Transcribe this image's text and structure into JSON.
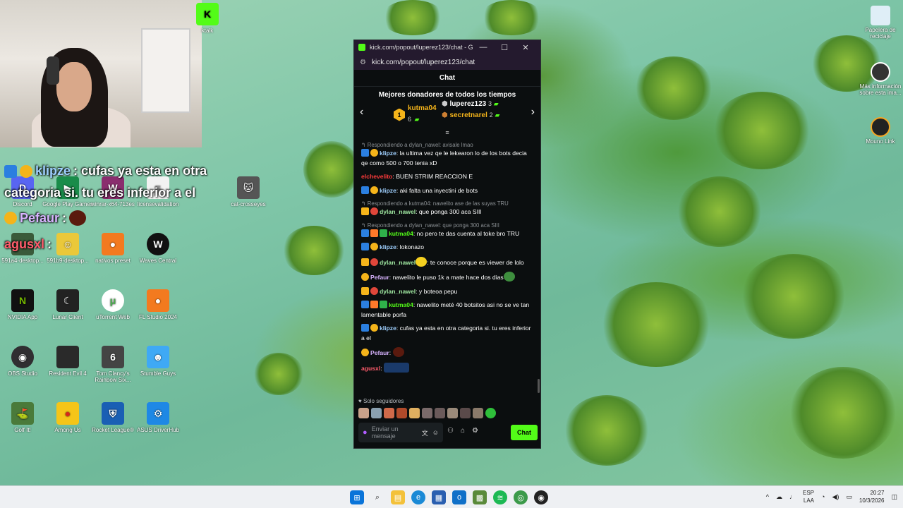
{
  "overlay": {
    "line1_user": "klipze",
    "line1_text": ": cufas ya esta en otra",
    "line2_text": "categoria si. tu eres inferior a el",
    "line3_user": "Pefaur",
    "line3_text": ":",
    "line4_user": "agusxl",
    "line4_text": ":"
  },
  "desktop_icons": [
    {
      "label": "Discord",
      "icon": "discord-icon"
    },
    {
      "label": "Google Play Games",
      "icon": "google-play-games-icon"
    },
    {
      "label": "winrar-x64-713es",
      "icon": "winrar-icon"
    },
    {
      "label": "licensevalidation",
      "icon": "file-icon"
    },
    {
      "label": "cat-crosseyes",
      "icon": "image-icon"
    },
    {
      "label": "591a4-desktop...",
      "icon": "image-icon"
    },
    {
      "label": "591b9-desktop...",
      "icon": "image-icon"
    },
    {
      "label": "nativos preset",
      "icon": "fl-studio-icon"
    },
    {
      "label": "Waves Central",
      "icon": "waves-icon"
    },
    {
      "label": "NVIDIA App",
      "icon": "nvidia-icon"
    },
    {
      "label": "Lunar Client",
      "icon": "lunar-client-icon"
    },
    {
      "label": "uTorrent Web",
      "icon": "utorrent-icon"
    },
    {
      "label": "FL Studio 2024",
      "icon": "fl-studio-icon"
    },
    {
      "label": "OBS Studio",
      "icon": "obs-icon"
    },
    {
      "label": "Resident Evil 4",
      "icon": "game-icon"
    },
    {
      "label": "Tom Clancy's Rainbow Six...",
      "icon": "rainbow-six-icon"
    },
    {
      "label": "Stumble Guys",
      "icon": "stumble-guys-icon"
    },
    {
      "label": "Golf It!",
      "icon": "golf-it-icon"
    },
    {
      "label": "Among Us",
      "icon": "among-us-icon"
    },
    {
      "label": "Rocket League®",
      "icon": "rocket-league-icon"
    },
    {
      "label": "ASUS DriverHub",
      "icon": "asus-icon"
    },
    {
      "label": "Papelera de reciclaje",
      "icon": "recycle-bin-icon"
    },
    {
      "label": "Más información sobre esta ima...",
      "icon": "info-icon"
    },
    {
      "label": "Mouno Link",
      "icon": "mouno-link-icon"
    },
    {
      "label": "ktalk",
      "icon": "kick-icon"
    }
  ],
  "window": {
    "title": "kick.com/popout/luperez123/chat - Googl...",
    "url": "kick.com/popout/luperez123/chat",
    "chat_header": "Chat",
    "donors_title": "Mejores donadores de todos los tiempos",
    "donor1": {
      "name": "kutma04",
      "count": "6",
      "rank": "1"
    },
    "donor2": {
      "name": "luperez123",
      "count": "3"
    },
    "donor3": {
      "name": "secretnarel",
      "count": "2"
    }
  },
  "messages": [
    {
      "reply": "Respondiendo a dylan_nawel: avisale lmao",
      "user": "klipze",
      "text": ": la ultima vez qe le lekearon lo de los bots decia qe como 500 o 700 tenia xD"
    },
    {
      "reply": "",
      "user": "elchevelito",
      "text": ": BUEN STRIM REACCION E"
    },
    {
      "reply": "",
      "user": "klipze",
      "text": ": aki falta una inyectini de bots"
    },
    {
      "reply": "Respondiendo a kutma04: nawelito ase de las suyas TRU",
      "user": "dylan_nawel",
      "text": ": que ponga 300 aca SIII"
    },
    {
      "reply": "Respondiendo a dylan_nawel: que ponga 300 aca SIII",
      "user": "kutma04",
      "text": ": no pero te das cuenta al toke bro TRU"
    },
    {
      "reply": "",
      "user": "klipze",
      "text": ": lokonazo"
    },
    {
      "reply": "",
      "user": "dylan_nawel",
      "text": ": te conoce porque es viewer de lolo"
    },
    {
      "reply": "",
      "user": "Pefaur",
      "text": ": nawelito le puso 1k a mate hace dos dias"
    },
    {
      "reply": "",
      "user": "dylan_nawel",
      "text": ": y boteoa pepu"
    },
    {
      "reply": "",
      "user": "kutma04",
      "text": ": nawelito meté 40 botsitos asi no se ve tan lamentable porfa"
    },
    {
      "reply": "",
      "user": "klipze",
      "text": ": cufas ya esta en otra categoria si. tu eres inferior a el"
    },
    {
      "reply": "",
      "user": "Pefaur",
      "text": ":"
    },
    {
      "reply": "",
      "user": "agusxl",
      "text": ":"
    }
  ],
  "footer": {
    "followers_only": "Solo seguidores",
    "input_placeholder": "Enviar un mensaje",
    "chat_button": "Chat"
  },
  "taskbar": {
    "lang1": "ESP",
    "lang2": "LAA",
    "time": "20:27",
    "date": "10/3/2026"
  },
  "colors": {
    "kick_green": "#53fc18",
    "chat_bg": "#0b0e0f",
    "titlebar_bg": "#241a2e"
  }
}
